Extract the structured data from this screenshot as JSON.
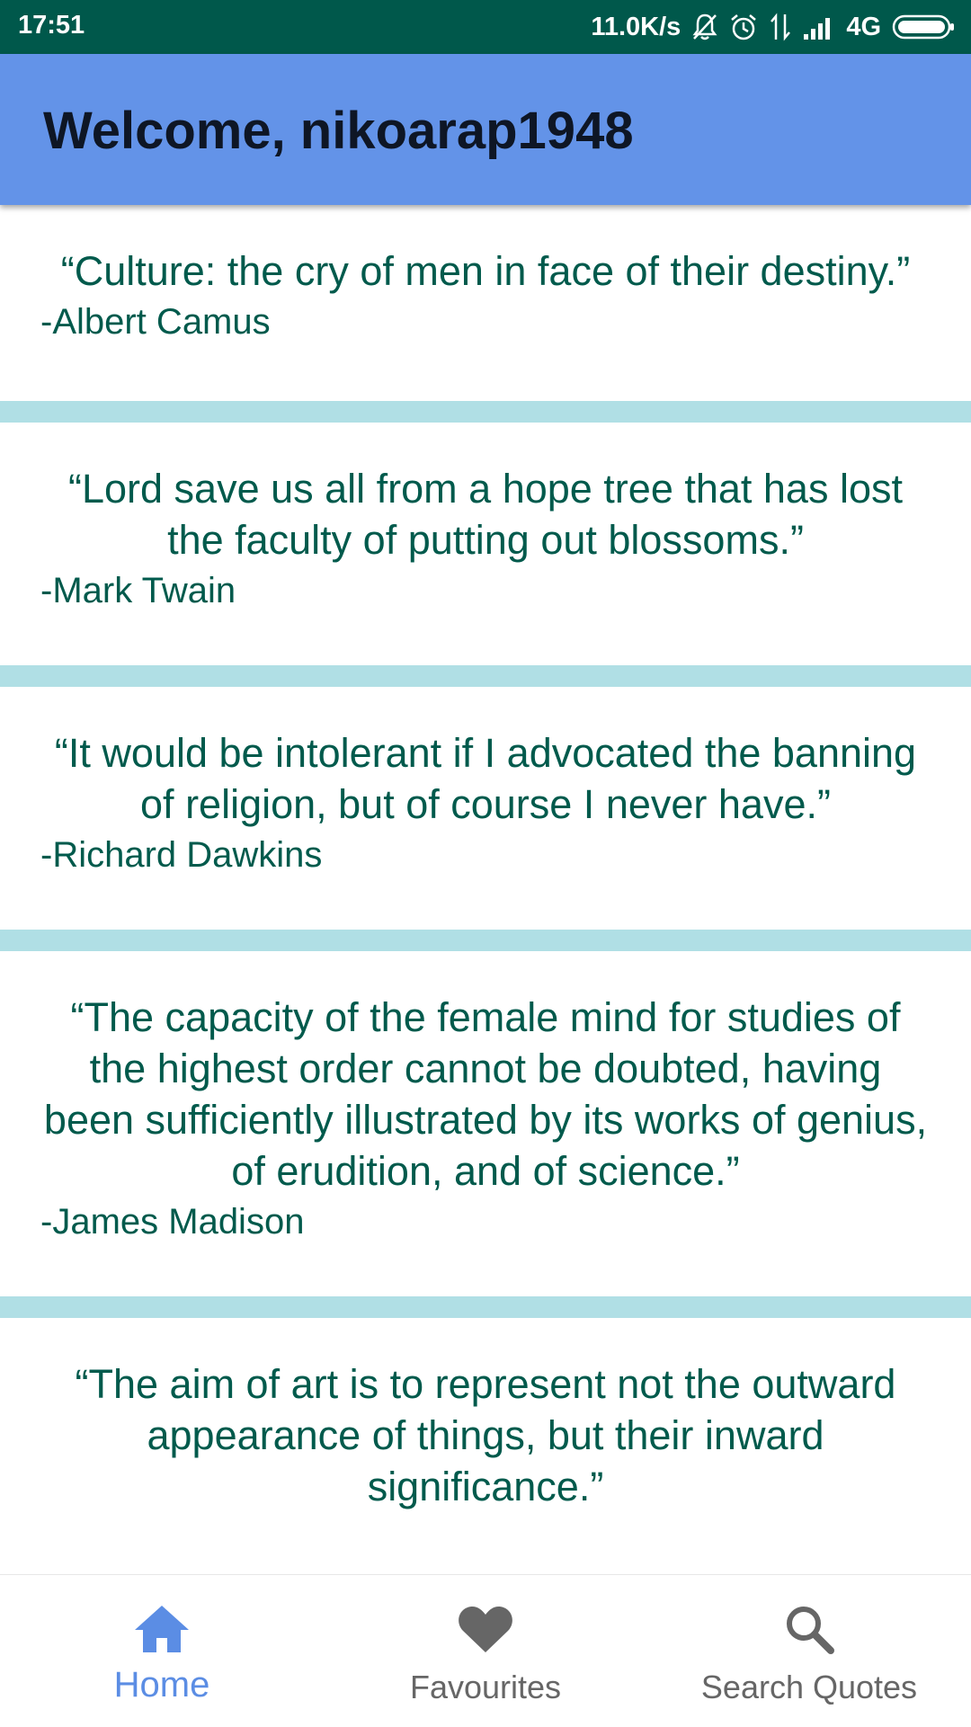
{
  "status_bar": {
    "time": "17:51",
    "network_speed": "11.0K/s",
    "network_type": "4G",
    "icons": [
      "bell-off-icon",
      "alarm-icon",
      "data-transfer-icon",
      "signal-icon",
      "battery-icon"
    ]
  },
  "app_bar": {
    "title": "Welcome, nikoarap1948",
    "background": "#6393e8"
  },
  "quotes": [
    {
      "text": "“Culture: the cry of men in face of their destiny.”",
      "author": "-Albert Camus"
    },
    {
      "text": "“Lord save us all from a hope tree that has lost the faculty of putting out blossoms.”",
      "author": "-Mark Twain"
    },
    {
      "text": "“It would be intolerant if I advocated the banning of religion, but of course I never have.”",
      "author": "-Richard Dawkins"
    },
    {
      "text": "“The capacity of the female mind for studies of the highest order cannot be doubted, having been sufficiently illustrated by its works of genius, of erudition, and of science.”",
      "author": "-James Madison"
    },
    {
      "text": "“The aim of art is to represent not the outward appearance of things, but their inward significance.”",
      "author": ""
    }
  ],
  "bottom_nav": {
    "items": [
      {
        "label": "Home",
        "icon": "home-icon",
        "active": true
      },
      {
        "label": "Favourites",
        "icon": "heart-icon",
        "active": false
      },
      {
        "label": "Search Quotes",
        "icon": "search-icon",
        "active": false
      }
    ],
    "active_color": "#5b8de4",
    "inactive_color": "#666666"
  },
  "colors": {
    "status_bar": "#00584b",
    "quote_text": "#005a4c",
    "divider": "#b0dfe5"
  }
}
